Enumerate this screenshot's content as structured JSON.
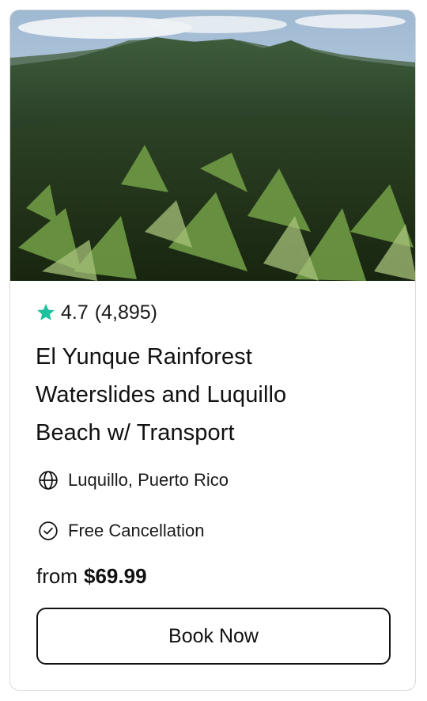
{
  "card": {
    "image": {
      "alt": "El Yunque Rainforest mountains and palm trees"
    },
    "rating": {
      "score": "4.7",
      "count": "(4,895)",
      "icon": "star-icon",
      "icon_color": "#1fc19c"
    },
    "title_lines": [
      "El Yunque Rainforest",
      "Waterslides and Luquillo",
      "Beach w/ Transport"
    ],
    "location": {
      "icon": "globe-icon",
      "text": "Luquillo, Puerto Rico"
    },
    "cancellation": {
      "icon": "check-circle-icon",
      "text": "Free Cancellation"
    },
    "price": {
      "prefix": "from",
      "amount": "$69.99"
    },
    "cta": {
      "label": "Book Now"
    }
  }
}
